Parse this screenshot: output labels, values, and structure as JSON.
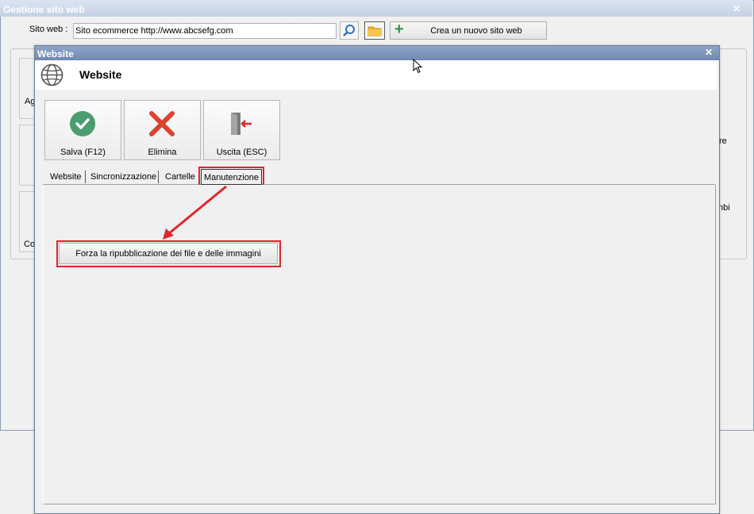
{
  "outer_window": {
    "title": "Gestione sito web",
    "close": "✕",
    "site_label": "Sito web :",
    "site_value": "Sito ecommerce http://www.abcsefg.com",
    "create_button": "Crea un nuovo sito web",
    "bg_text_1": "Ag",
    "bg_text_2": "Co",
    "bg_text_3": "re",
    "bg_text_4": "nbi"
  },
  "dialog": {
    "title": "Website",
    "close": "✕",
    "heading": "Website",
    "toolbar": {
      "save": "Salva (F12)",
      "delete": "Elimina",
      "exit": "Uscita (ESC)"
    },
    "tabs": [
      "Website",
      "Sincronizzazione",
      "Cartelle",
      "Manutenzione"
    ],
    "active_tab": "Manutenzione",
    "force_button": "Forza la ripubblicazione dei file e delle immagini"
  },
  "colors": {
    "highlight": "#e2252b",
    "save_icon": "#4a9d6e",
    "delete_icon": "#d9432f",
    "title_bar": "#6d88b2"
  }
}
